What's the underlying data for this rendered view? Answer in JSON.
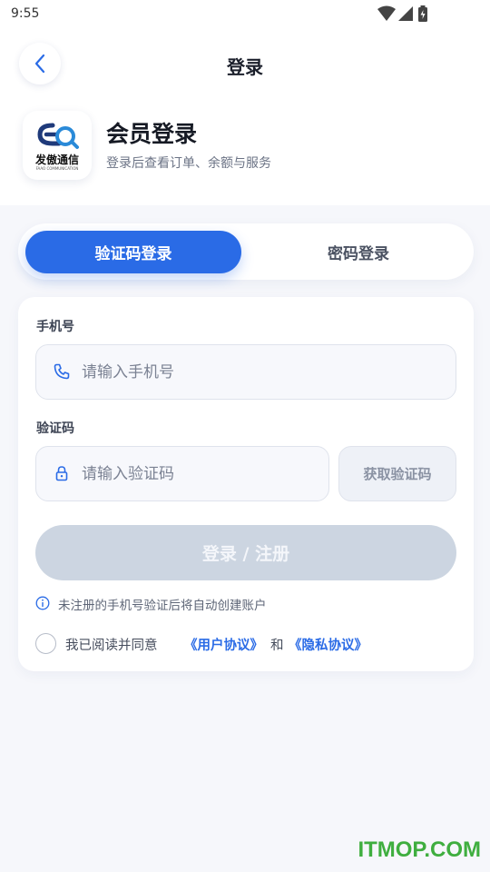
{
  "status_bar": {
    "time": "9:55"
  },
  "nav": {
    "title": "登录"
  },
  "header": {
    "logo_text": "发傲通信",
    "logo_subtext": "FAAO COMMUNICATION",
    "title": "会员登录",
    "subtitle": "登录后查看订单、余额与服务"
  },
  "tabs": [
    {
      "label": "验证码登录",
      "active": true
    },
    {
      "label": "密码登录",
      "active": false
    }
  ],
  "form": {
    "phone": {
      "label": "手机号",
      "placeholder": "请输入手机号",
      "value": ""
    },
    "code": {
      "label": "验证码",
      "placeholder": "请输入验证码",
      "value": ""
    },
    "get_code_label": "获取验证码",
    "submit_label": "登录 / 注册",
    "hint": "未注册的手机号验证后将自动创建账户",
    "agreement": {
      "prefix": "我已阅读并同意",
      "user_agreement": "《用户协议》",
      "conjunction": "和",
      "privacy_policy": "《隐私协议》",
      "checked": false
    }
  },
  "watermark": "ITMOP.COM",
  "colors": {
    "accent": "#2a6be6",
    "submit_disabled": "#ccd5e1",
    "page_bg": "#f6f7fb",
    "watermark": "#3fae3f"
  }
}
